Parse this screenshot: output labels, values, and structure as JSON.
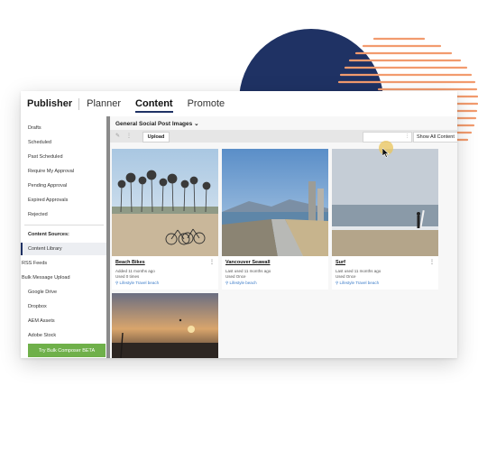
{
  "header": {
    "brand": "Publisher",
    "tabs": [
      {
        "label": "Planner",
        "active": false
      },
      {
        "label": "Content",
        "active": true
      },
      {
        "label": "Promote",
        "active": false
      }
    ]
  },
  "sidebar": {
    "items": [
      "Drafts",
      "Scheduled",
      "Past Scheduled",
      "Require My Approval",
      "Pending Approval",
      "Expired Approvals",
      "Rejected"
    ],
    "sources_heading": "Content Sources:",
    "sources": [
      "Content Library",
      "RSS Feeds",
      "Bulk Message Upload",
      "Google Drive",
      "Dropbox",
      "AEM Assets",
      "Adobe Stock"
    ],
    "selected_source": "Content Library",
    "bulk_button": "Try Bulk Composer BETA"
  },
  "main": {
    "section_title": "General Social Post Images ⌄",
    "upload_label": "Upload",
    "filter_label": "Show All Content",
    "cards": [
      {
        "title": "Beach Bikes",
        "line1": "Added 11 months ago",
        "line2": "Used 0 times",
        "tags": "Lifestyle  Travel  beach",
        "image": "beach-bikes"
      },
      {
        "title": "Vancouver Seawall",
        "line1": "Last used 11 months ago",
        "line2": "Used Once",
        "tags": "Lifestyle  beach",
        "image": "seawall"
      },
      {
        "title": "Surf",
        "line1": "Last used 11 months ago",
        "line2": "Used Once",
        "tags": "Lifestyle  Travel  beach",
        "image": "surf"
      },
      {
        "title": "",
        "image": "sunset"
      }
    ]
  },
  "icons": {
    "edit": "edit-icon",
    "more": "more-vertical-icon",
    "tag": "tag-icon",
    "cursor": "cursor-icon"
  },
  "colors": {
    "navy": "#1f3264",
    "orange": "#f29b6e",
    "green": "#6fb04a",
    "link": "#3a7bc8"
  }
}
